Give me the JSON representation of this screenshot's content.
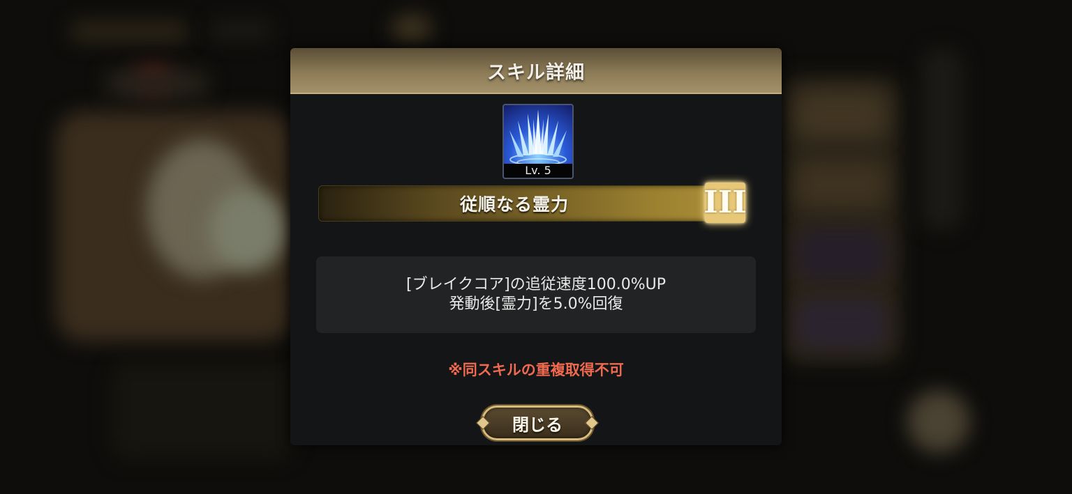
{
  "dialog": {
    "title": "スキル詳細",
    "skill": {
      "icon": "ice-spikes-icon",
      "level_label": "Lv. 5",
      "name": "従順なる霊力",
      "rank_emblem": "III"
    },
    "description": {
      "line1": "[ブレイクコア]の追従速度100.0%UP",
      "line2": "発動後[霊力]を5.0%回復"
    },
    "warning": "※同スキルの重複取得不可",
    "close_button": "閉じる"
  },
  "colors": {
    "header_gold": "#8c7b56",
    "warning_red": "#f06a4f",
    "panel_bg": "#141516"
  }
}
